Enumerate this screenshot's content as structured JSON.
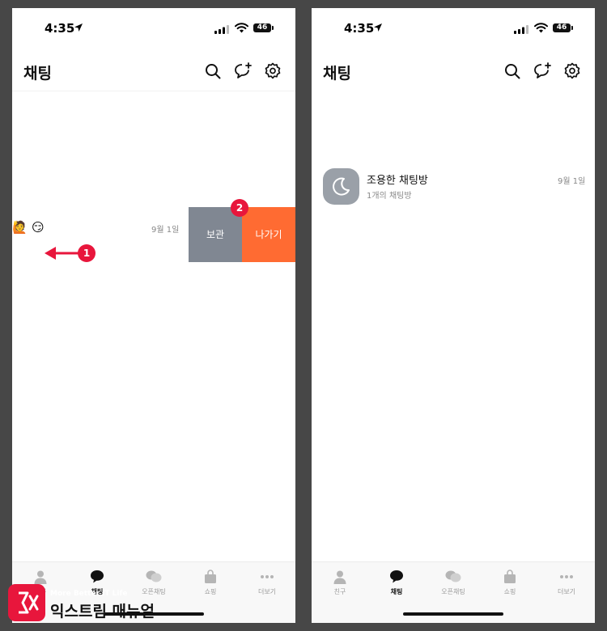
{
  "status_bar": {
    "time": "4:35",
    "battery": "46"
  },
  "left_screen": {
    "title": "채팅",
    "swipe_row": {
      "date": "9월 1일",
      "emoji_1": "🙋",
      "emoji_2": "😏",
      "archive_label": "보관",
      "leave_label": "나가기"
    },
    "badges": [
      "1",
      "2"
    ]
  },
  "right_screen": {
    "title": "채팅",
    "chat_row": {
      "name": "조용한 채팅방",
      "preview": "1개의 채팅방",
      "date": "9월 1일",
      "avatar_icon": "moon-icon"
    }
  },
  "tabs": [
    {
      "label": "친구",
      "icon": "person-icon"
    },
    {
      "label": "채팅",
      "icon": "chat-bubble-icon",
      "active": true
    },
    {
      "label": "오픈채팅",
      "icon": "open-chat-icon"
    },
    {
      "label": "쇼핑",
      "icon": "shopping-bag-icon"
    },
    {
      "label": "더보기",
      "icon": "more-dots-icon"
    }
  ],
  "watermark": {
    "tagline": "More Better IT Life",
    "name": "익스트림 매뉴얼"
  },
  "colors": {
    "archive": "#808792",
    "leave": "#ff6b32",
    "badge": "#e8163c",
    "background": "#474747"
  }
}
